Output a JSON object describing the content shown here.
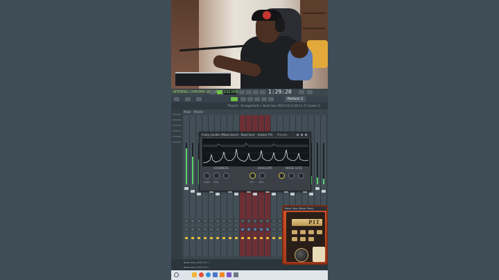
{
  "toolbar": {
    "hint": "OPENING CHROMA SETUP",
    "tempo": "132.000",
    "time": "1:29:20",
    "pattern": "Pattern 2"
  },
  "playlist": {
    "title": "Playlist - Arrangement > Beat-here 2023-03-13 06-11-21 (Lowe-1)"
  },
  "mixer": {
    "title": "Mixer - Master"
  },
  "limiter": {
    "title": "Fruity Limiter (Mixer-Insert - Beat-here - master FX)",
    "preset": "Presets",
    "loudness_label": "LOUDNESS",
    "envelope_label": "ENVELOPE",
    "noise_gate_label": "NOISE GATE",
    "knob_labels": [
      "GAIN",
      "CEIL",
      "ATT",
      "REL"
    ]
  },
  "amp": {
    "title": "Retro Tube (Mixer Pitch)",
    "brand": "PIT"
  },
  "channels": [
    "Beat-here_2023-03-13 06-11",
    "Beat-here_2023-03-13 06-11"
  ],
  "colors": {
    "accent_green": "#8fe35c",
    "meter_green": "#5bd06a",
    "insert_red": "#6b2f35",
    "amp_orange": "#d4522b"
  },
  "taskbar": {
    "icons": [
      "search-icon",
      "file-explorer-icon",
      "chrome-icon",
      "edge-icon",
      "mail-icon",
      "fl-studio-icon",
      "store-icon",
      "settings-icon"
    ]
  }
}
